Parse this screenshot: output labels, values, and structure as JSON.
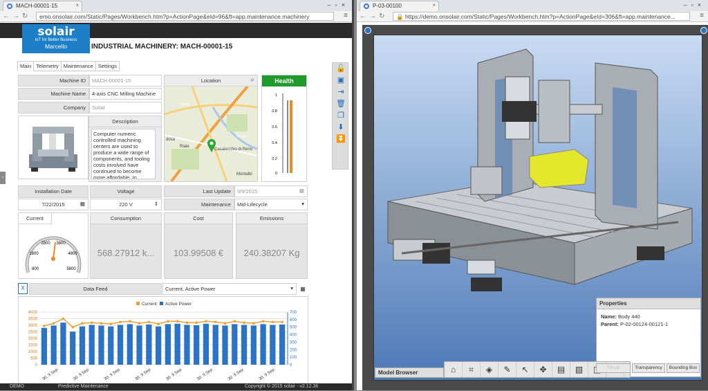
{
  "left_window": {
    "tab_title": "MACH-00001-15",
    "url": "emo.onsolair.com/Static/Pages/Workbench.htm?p=ActionPage&eId=96&ft=app.maintenance.machinery",
    "brand": "solair",
    "tagline": "IoT for Better Business",
    "user": "Marcello",
    "page_title": "INDUSTRIAL MACHINERY: MACH-00001-15",
    "subtabs": [
      "Main",
      "Telemetry",
      "Maintenance",
      "Settings"
    ],
    "fields": {
      "machine_id_label": "Machine ID",
      "machine_id_value": "MACH-00001-15",
      "machine_name_label": "Machine Name",
      "machine_name_value": "4-axis CNC Milling Machine",
      "company_label": "Company",
      "company_value": "Solair",
      "description_label": "Description",
      "description_text": "Computer numeric controlled machining centers are used to produce a wide range of components, and tooling costs involved have continued to become more affordable. In general, large production runs requiring",
      "location_label": "Location",
      "installation_date_label": "Installation Date",
      "installation_date_value": "7/22/2015",
      "voltage_label": "Voltage",
      "voltage_value": "220 V",
      "last_update_label": "Last Update",
      "last_update_value": "9/9/2015",
      "maintenance_label": "Maintenance",
      "maintenance_value": "Mid-Lifecycle"
    },
    "health": {
      "title": "Health",
      "ticks": [
        "1",
        "0.8",
        "0.6",
        "0.4",
        "0.2",
        "0"
      ]
    },
    "map_labels": [
      "SP26",
      "Riale",
      "Casalecchio di Reno",
      "SP569",
      "Montalbi",
      "dosa"
    ],
    "gauges": {
      "current_label": "Current",
      "current_ticks": [
        "800",
        "1800",
        "2800",
        "3800",
        "4800",
        "5800"
      ],
      "consumption_label": "Consumption",
      "consumption_value": "568.27912 k...",
      "cost_label": "Cost",
      "cost_value": "103.99508 €",
      "emissions_label": "Emissions",
      "emissions_value": "240.38207 Kg"
    },
    "datafeed": {
      "label": "Data Feed",
      "selected": "Current, Active Power"
    },
    "footer": {
      "left": "DEMO",
      "middle": "Predictive Maintenance",
      "right": "Copyright © 2015 solair - v2.12.36"
    }
  },
  "chart_data": {
    "type": "bar",
    "legend": [
      "Current",
      "Active Power"
    ],
    "legend_position": "top",
    "categories": [
      "30. 9 Sep",
      "30. 9 Sep",
      "30. 9 Sep",
      "30. 9 Sep",
      "30. 9 Sep",
      "30. 9 Sep",
      "30. 9 Sep",
      "30. 9 Sep",
      "30. 9 Sep",
      "30. 9 Sep",
      "30. 9 Sep",
      "30. 9 Sep",
      "30. 9 Sep",
      "30. 9 Sep",
      "30. 9 Sep",
      "30. 9 Sep",
      "30. 9 Sep",
      "30. 9 Sep",
      "30. 9 Sep",
      "30. 9 Sep",
      "30. 9 Sep",
      "30. 9 Sep",
      "30. 9 Sep",
      "30. 9 Sep",
      "30. 9 Sep",
      "30. 9 Sep"
    ],
    "category_labels_shown": [
      "30. 9 Sep",
      "30. 9 Sep",
      "30. 9 Sep",
      "30. 9 Sep",
      "30. 9 Sep",
      "30. 9 Sep",
      "30. 9 Sep",
      "30. 9 Sep"
    ],
    "series": [
      {
        "name": "Active Power",
        "type": "bar",
        "axis": "right",
        "color": "#2a73c5",
        "values": [
          490,
          520,
          560,
          440,
          510,
          530,
          520,
          510,
          530,
          540,
          520,
          535,
          510,
          540,
          545,
          530,
          525,
          545,
          530,
          520,
          540,
          530,
          520,
          540,
          530,
          535
        ]
      },
      {
        "name": "Current",
        "type": "line",
        "axis": "left",
        "color": "#f0a030",
        "values": [
          2950,
          3150,
          3500,
          2850,
          3150,
          3200,
          3150,
          3100,
          3250,
          3300,
          3150,
          3250,
          3100,
          3300,
          3300,
          3200,
          3200,
          3300,
          3250,
          3150,
          3300,
          3200,
          3150,
          3300,
          3250,
          3250
        ]
      }
    ],
    "y_left": {
      "ticks": [
        "0",
        "500",
        "1000",
        "1500",
        "2000",
        "2500",
        "3000",
        "3500",
        "4000"
      ],
      "range": [
        0,
        4000
      ]
    },
    "y_right": {
      "ticks": [
        "0",
        "100",
        "200",
        "300",
        "400",
        "500",
        "600",
        "700"
      ],
      "range": [
        0,
        700
      ]
    },
    "grid": true
  },
  "right_window": {
    "tab_title": "P-03-00100",
    "url": "https://demo.onsolair.com/Static/Pages/Workbench.htm?p=ActionPage&eId=306&ft=app.maintenance...",
    "properties": {
      "title": "Properties",
      "name_label": "Name:",
      "name_value": "Body 440",
      "parent_label": "Parent:",
      "parent_value": "P-02-00124-00121-1"
    },
    "model_browser": "Model Browser",
    "buttons": {
      "transparency": "Transparency",
      "bounding_box": "Bounding Box",
      "extra": "Thrust"
    }
  }
}
